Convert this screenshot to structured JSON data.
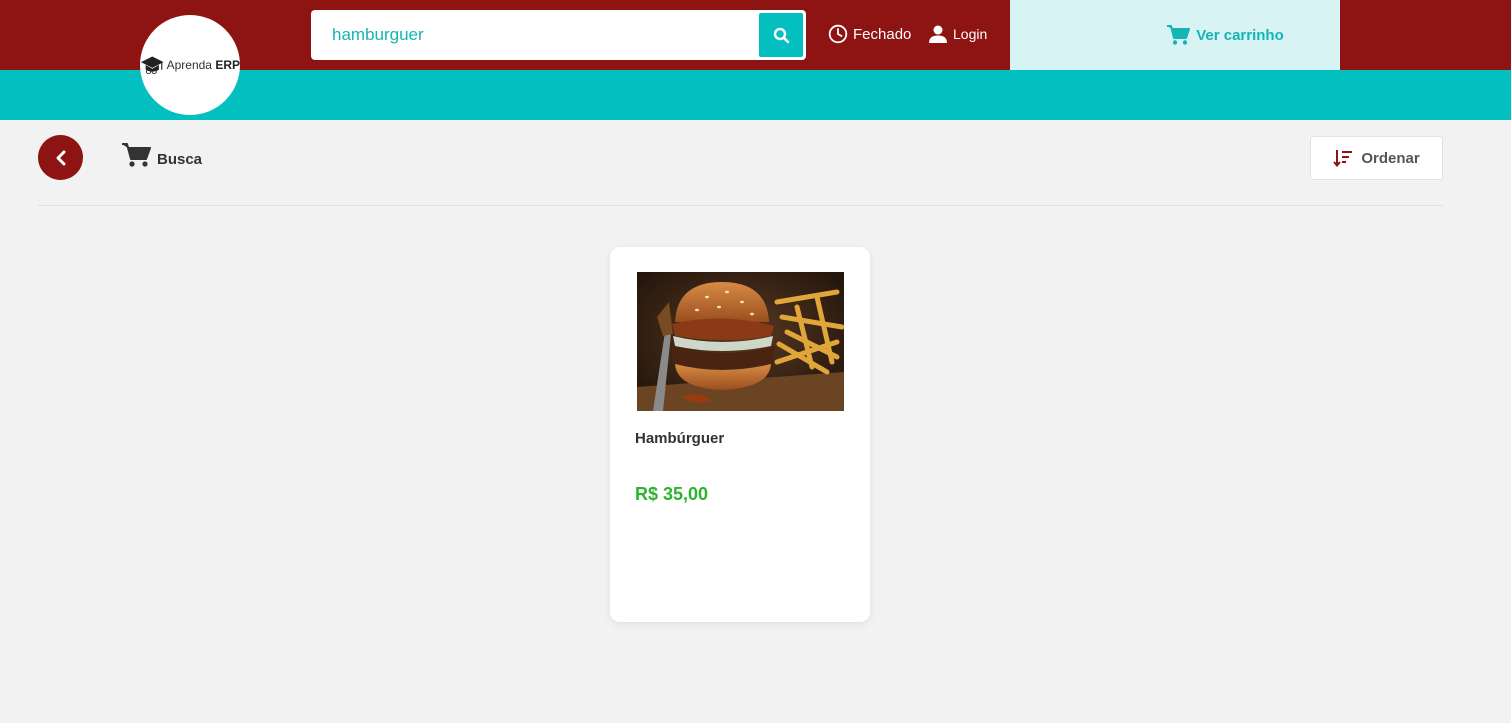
{
  "brand": {
    "name_part1": "Aprenda ",
    "name_part2": "ERP"
  },
  "search": {
    "value": "hamburguer",
    "placeholder": ""
  },
  "header": {
    "status_label": "Fechado",
    "login_label": "Login",
    "cart_label": "Ver carrinho"
  },
  "breadcrumb": {
    "label": "Busca"
  },
  "toolbar": {
    "sort_label": "Ordenar"
  },
  "products": [
    {
      "name": "Hambúrguer",
      "price": "R$ 35,00"
    }
  ],
  "colors": {
    "primary": "#8e1414",
    "accent": "#03bfbf",
    "cart_bg": "#d8f3f3",
    "price": "#2db32d"
  },
  "icons": [
    "graduation-cap-icon",
    "search-icon",
    "clock-icon",
    "user-icon",
    "cart-icon",
    "chevron-left-icon",
    "sort-icon"
  ]
}
